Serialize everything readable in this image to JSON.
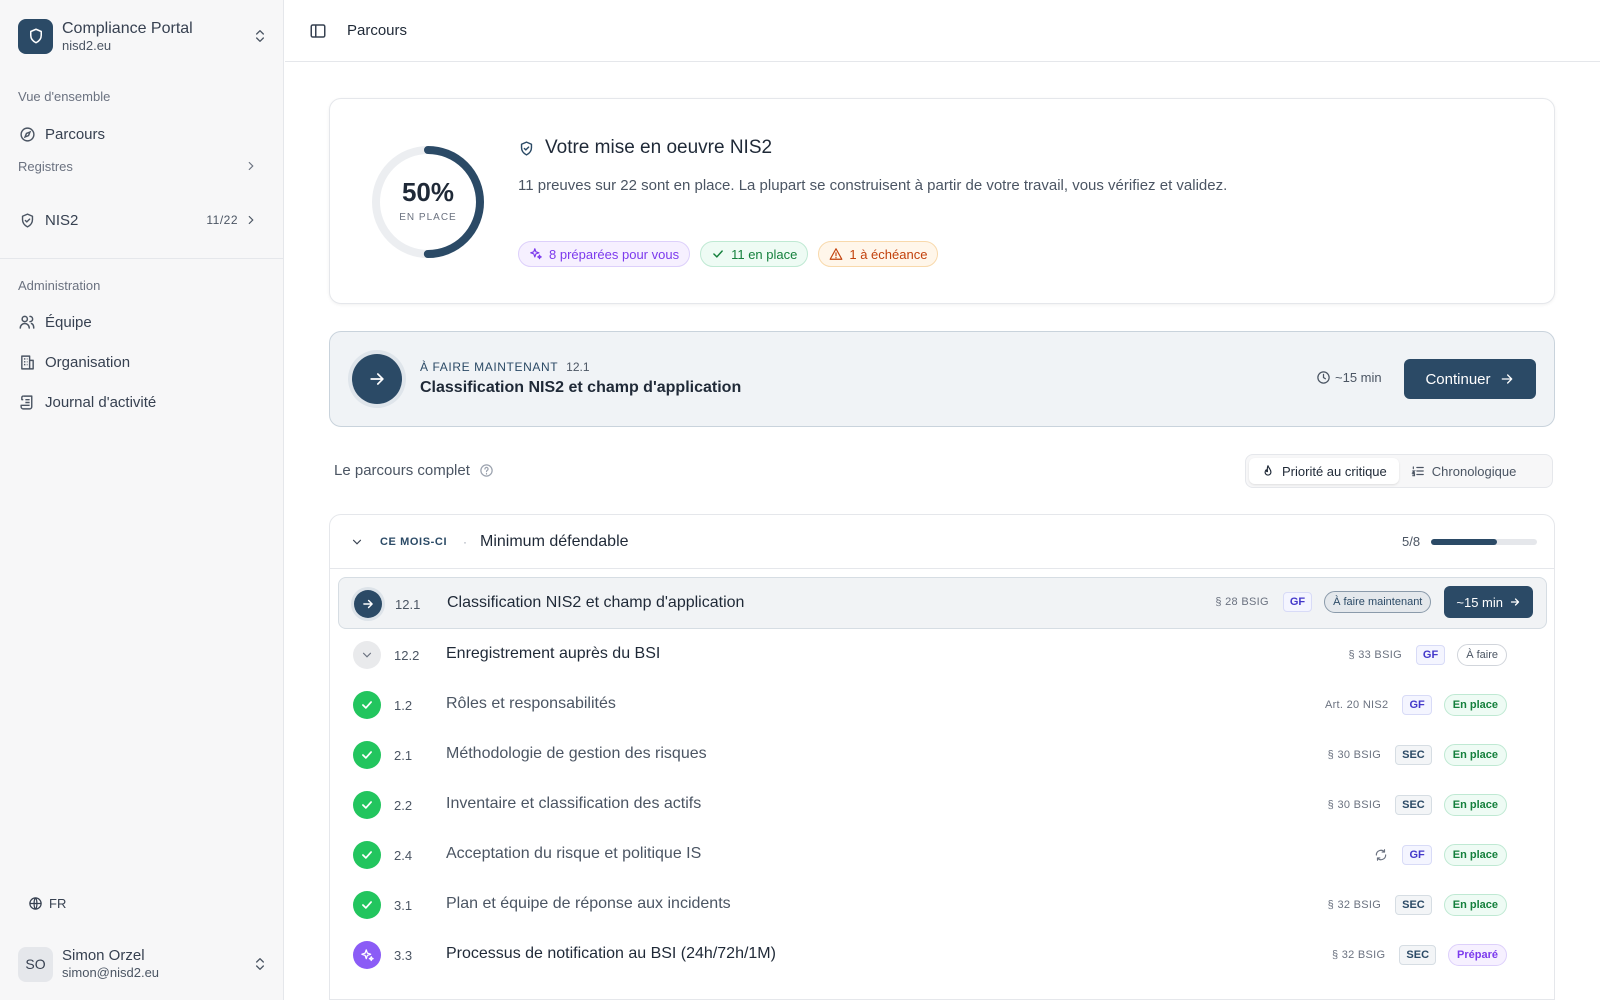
{
  "brand": {
    "name": "Compliance Portal",
    "domain": "nisd2.eu"
  },
  "sidebar": {
    "section_overview": "Vue d'ensemble",
    "item_parcours": "Parcours",
    "registres": "Registres",
    "nis2": {
      "label": "NIS2",
      "count": "11/22"
    },
    "section_admin": "Administration",
    "item_equipe": "Équipe",
    "item_organisation": "Organisation",
    "item_journal": "Journal d'activité",
    "lang": "FR",
    "user": {
      "initials": "SO",
      "name": "Simon Orzel",
      "email": "simon@nisd2.eu"
    }
  },
  "header": {
    "breadcrumb": "Parcours"
  },
  "overview": {
    "percent": 50,
    "percent_label": "50%",
    "ring_label": "EN PLACE",
    "title": "Votre mise en oeuvre NIS2",
    "description": "11 preuves sur 22 sont en place. La plupart se construisent à partir de votre travail, vous vérifiez et validez.",
    "chips": {
      "prepared": "8 préparées pour vous",
      "in_place": "11 en place",
      "due": "1 à échéance"
    }
  },
  "now": {
    "eyebrow": "À FAIRE MAINTENANT",
    "number": "12.1",
    "title": "Classification NIS2 et champ d'application",
    "time": "~15 min",
    "button": "Continuer"
  },
  "journey": {
    "title": "Le parcours complet",
    "sort": {
      "critical": "Priorité au critique",
      "chrono": "Chronologique"
    }
  },
  "group": {
    "tag": "CE MOIS-CI",
    "dot": "·",
    "name": "Minimum défendable",
    "count": "5/8",
    "progress": 0.625
  },
  "rows": [
    {
      "num": "12.1",
      "title": "Classification NIS2 et champ d'application",
      "ref": "§ 28 BSIG",
      "tag": "GF",
      "status": "À faire maintenant",
      "time": "~15 min"
    },
    {
      "num": "12.2",
      "title": "Enregistrement auprès du BSI",
      "ref": "§ 33 BSIG",
      "tag": "GF",
      "status": "À faire"
    },
    {
      "num": "1.2",
      "title": "Rôles et responsabilités",
      "ref": "Art. 20 NIS2",
      "tag": "GF",
      "status": "En place"
    },
    {
      "num": "2.1",
      "title": "Méthodologie de gestion des risques",
      "ref": "§ 30 BSIG",
      "tag": "SEC",
      "status": "En place"
    },
    {
      "num": "2.2",
      "title": "Inventaire et classification des actifs",
      "ref": "§ 30 BSIG",
      "tag": "SEC",
      "status": "En place"
    },
    {
      "num": "2.4",
      "title": "Acceptation du risque et politique IS",
      "ref": "",
      "tag": "GF",
      "status": "En place"
    },
    {
      "num": "3.1",
      "title": "Plan et équipe de réponse aux incidents",
      "ref": "§ 32 BSIG",
      "tag": "SEC",
      "status": "En place"
    },
    {
      "num": "3.3",
      "title": "Processus de notification au BSI (24h/72h/1M)",
      "ref": "§ 32 BSIG",
      "tag": "SEC",
      "status": "Préparé"
    }
  ]
}
